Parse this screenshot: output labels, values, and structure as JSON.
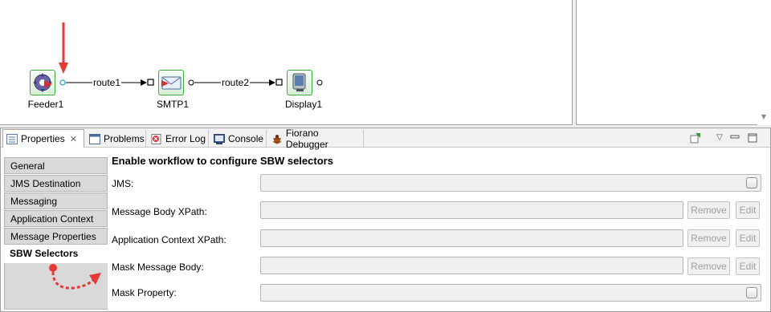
{
  "canvas": {
    "nodes": [
      {
        "label": "Feeder1",
        "icon": "feeder-gear-icon"
      },
      {
        "label": "SMTP1",
        "icon": "smtp-mail-icon"
      },
      {
        "label": "Display1",
        "icon": "display-monitor-icon"
      }
    ],
    "routes": [
      {
        "label": "route1"
      },
      {
        "label": "route2"
      }
    ],
    "annotation_color": "#e53935",
    "node_border_color": "#3cae3c"
  },
  "tabs": [
    {
      "label": "Properties",
      "icon": "properties-icon",
      "active": true
    },
    {
      "label": "Problems",
      "icon": "problems-icon"
    },
    {
      "label": "Error Log",
      "icon": "error-log-icon"
    },
    {
      "label": "Console",
      "icon": "console-icon"
    },
    {
      "label": "Fiorano Debugger",
      "icon": "debugger-bug-icon"
    }
  ],
  "side_tabs": [
    {
      "label": "General"
    },
    {
      "label": "JMS Destination"
    },
    {
      "label": "Messaging"
    },
    {
      "label": "Application Context"
    },
    {
      "label": "Message Properties"
    },
    {
      "label": "SBW Selectors",
      "selected": true
    }
  ],
  "section": {
    "title": "Enable workflow to configure SBW selectors",
    "fields": [
      {
        "label": "JMS:"
      },
      {
        "label": "Message Body XPath:"
      },
      {
        "label": "Application Context XPath:"
      },
      {
        "label": "Mask Message Body:"
      },
      {
        "label": "Mask Property:"
      }
    ],
    "remove_label": "Remove",
    "edit_label": "Edit"
  }
}
